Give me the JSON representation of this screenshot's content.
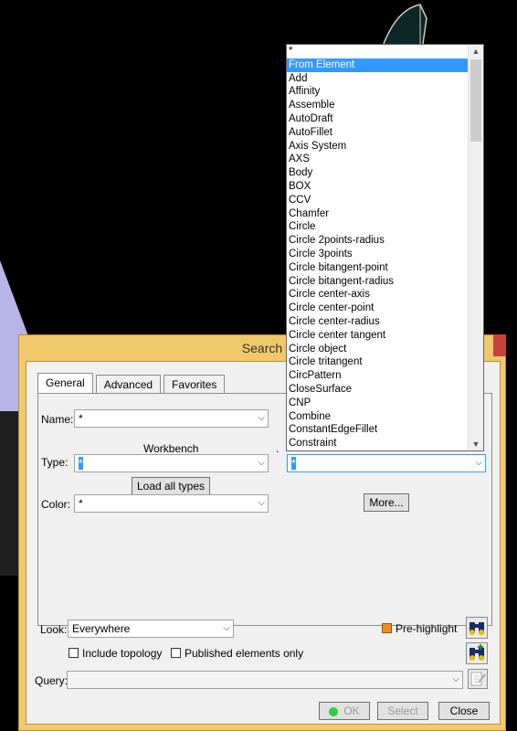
{
  "dialog": {
    "title": "Search",
    "tabs": [
      "General",
      "Advanced",
      "Favorites"
    ],
    "name": {
      "label": "Name:",
      "value": "*"
    },
    "workbench": {
      "label": "Workbench",
      "value": "*"
    },
    "dot": ".",
    "type": {
      "label": "Type:",
      "value": "*"
    },
    "load_all_types": "Load all types",
    "color": {
      "label": "Color:",
      "value": "*"
    },
    "more_button": "More...",
    "look": {
      "label": "Look:",
      "value": "Everywhere"
    },
    "prehighlight": "Pre-highlight",
    "include_topology": "Include topology",
    "published_only": "Published elements only",
    "query": {
      "label": "Query:",
      "value": ""
    },
    "ok_button": "OK",
    "select_button": "Select",
    "close_button": "Close"
  },
  "dropdown": {
    "selected_index": 1,
    "items": [
      "*",
      "From Element",
      "Add",
      "Affinity",
      "Assemble",
      "AutoDraft",
      "AutoFillet",
      "Axis System",
      "AXS",
      "Body",
      "BOX",
      "CCV",
      "Chamfer",
      "Circle",
      "Circle 2points-radius",
      "Circle 3points",
      "Circle bitangent-point",
      "Circle bitangent-radius",
      "Circle center-axis",
      "Circle center-point",
      "Circle center-radius",
      "Circle center tangent",
      "Circle object",
      "Circle tritangent",
      "CircPattern",
      "CloseSurface",
      "CNP",
      "Combine",
      "ConstantEdgeFillet",
      "Constraint"
    ]
  },
  "colors": {
    "dialog_frame": "#f2c96e",
    "selection": "#3399ff",
    "ok_light": "#2ecc40"
  }
}
